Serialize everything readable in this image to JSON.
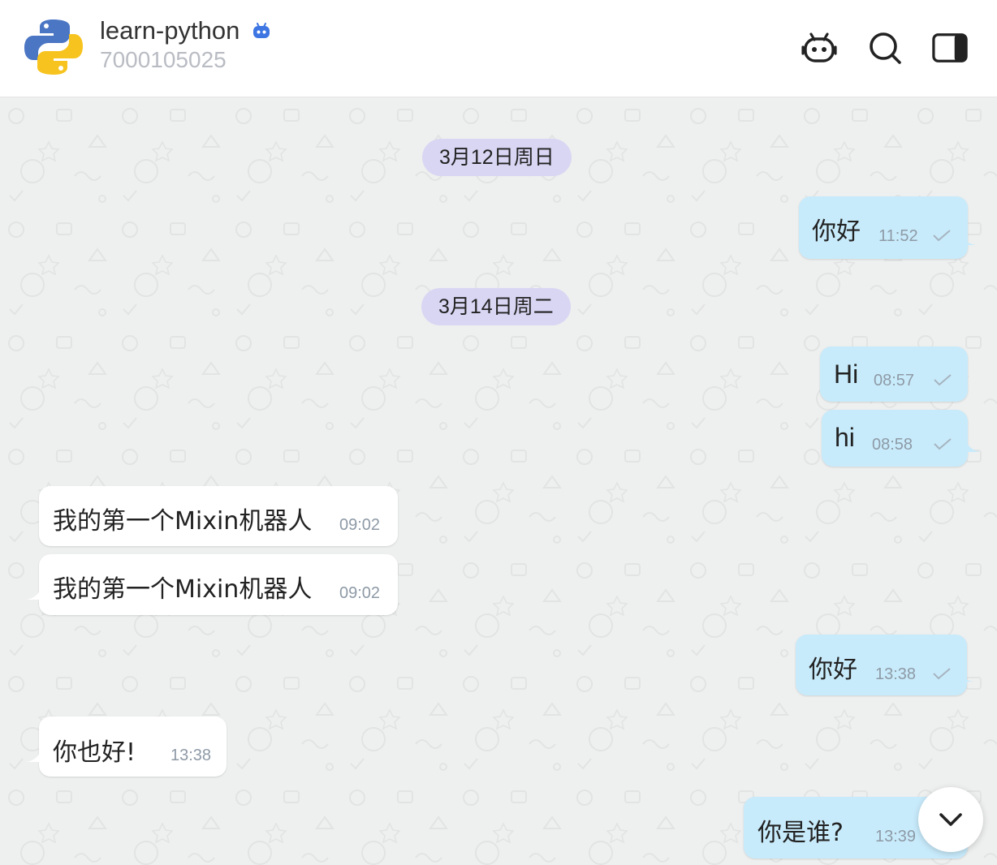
{
  "header": {
    "title": "learn-python",
    "subtitle": "7000105025",
    "icons": {
      "bot_badge": "robot-badge-icon",
      "bot_button": "bot-icon",
      "search_button": "search-icon",
      "panel_button": "sidebar-panel-icon"
    }
  },
  "chat": {
    "dates": [
      "3月12日周日",
      "3月14日周二"
    ],
    "messages": [
      {
        "direction": "out",
        "text": "你好",
        "time": "11:52",
        "status": "sent"
      },
      {
        "direction": "out",
        "text": "Hi",
        "time": "08:57",
        "status": "sent"
      },
      {
        "direction": "out",
        "text": "hi",
        "time": "08:58",
        "status": "sent"
      },
      {
        "direction": "in",
        "text": "我的第一个Mixin机器人",
        "time": "09:02"
      },
      {
        "direction": "in",
        "text": "我的第一个Mixin机器人",
        "time": "09:02"
      },
      {
        "direction": "out",
        "text": "你好",
        "time": "13:38",
        "status": "sent"
      },
      {
        "direction": "in",
        "text": "你也好!",
        "time": "13:38"
      },
      {
        "direction": "out",
        "text": "你是谁?",
        "time": "13:39",
        "status": "sent"
      }
    ],
    "scroll_button_icon": "chevron-down-icon"
  },
  "colors": {
    "outgoing_bubble": "#c8ebfb",
    "incoming_bubble": "#ffffff",
    "date_chip": "#d8d6f3",
    "chat_background": "#eeefef",
    "bot_badge": "#3d75e3"
  }
}
